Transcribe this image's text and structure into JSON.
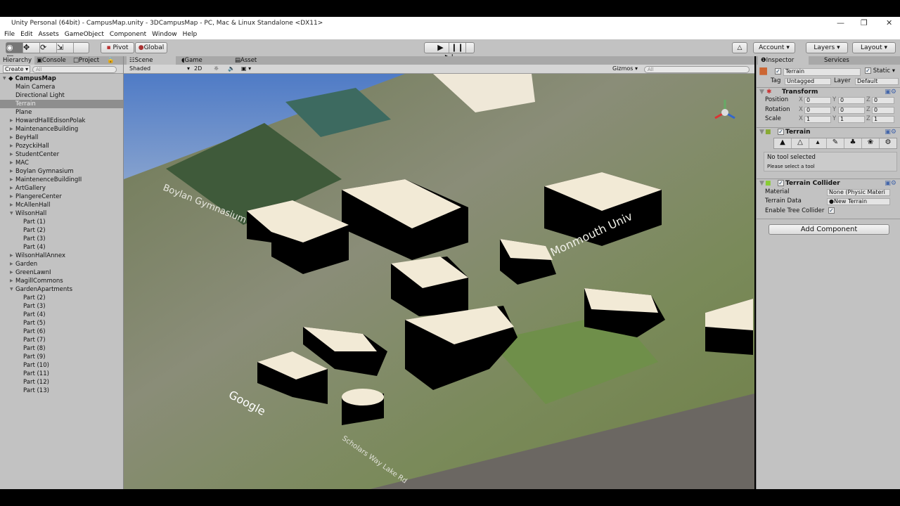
{
  "window": {
    "title": "Unity Personal (64bit) - CampusMap.unity - 3DCampusMap - PC, Mac & Linux Standalone <DX11>"
  },
  "menu": [
    "File",
    "Edit",
    "Assets",
    "GameObject",
    "Component",
    "Window",
    "Help"
  ],
  "toolbar": {
    "pivot": "Pivot",
    "global": "Global",
    "account": "Account",
    "layers": "Layers",
    "layout": "Layout"
  },
  "hierarchy": {
    "tabs": [
      "Hierarchy",
      "Console",
      "Project"
    ],
    "create": "Create",
    "search_placeholder": "All",
    "root": "CampusMap",
    "items": [
      {
        "label": "Main Camera",
        "indent": 1
      },
      {
        "label": "Directional Light",
        "indent": 1
      },
      {
        "label": "Terrain",
        "indent": 1,
        "selected": true
      },
      {
        "label": "Plane",
        "indent": 1
      },
      {
        "label": "HowardHallEdisonPolak",
        "indent": 1,
        "expander": "collapsed"
      },
      {
        "label": "MaintenanceBuilding",
        "indent": 1,
        "expander": "collapsed"
      },
      {
        "label": "BeyHall",
        "indent": 1,
        "expander": "collapsed"
      },
      {
        "label": "PozyckiHall",
        "indent": 1,
        "expander": "collapsed"
      },
      {
        "label": "StudentCenter",
        "indent": 1,
        "expander": "collapsed"
      },
      {
        "label": "MAC",
        "indent": 1,
        "expander": "collapsed"
      },
      {
        "label": "Boylan Gymnasium",
        "indent": 1,
        "expander": "collapsed"
      },
      {
        "label": "MaintenenceBuildingII",
        "indent": 1,
        "expander": "collapsed"
      },
      {
        "label": "ArtGallery",
        "indent": 1,
        "expander": "collapsed"
      },
      {
        "label": "PlangereCenter",
        "indent": 1,
        "expander": "collapsed"
      },
      {
        "label": "McAllenHall",
        "indent": 1,
        "expander": "collapsed"
      },
      {
        "label": "WilsonHall",
        "indent": 1,
        "expander": "expanded"
      },
      {
        "label": "Part (1)",
        "indent": 2
      },
      {
        "label": "Part (2)",
        "indent": 2
      },
      {
        "label": "Part (3)",
        "indent": 2
      },
      {
        "label": "Part (4)",
        "indent": 2
      },
      {
        "label": "WilsonHallAnnex",
        "indent": 1,
        "expander": "collapsed"
      },
      {
        "label": "Garden",
        "indent": 1,
        "expander": "collapsed"
      },
      {
        "label": "GreenLawnI",
        "indent": 1,
        "expander": "collapsed"
      },
      {
        "label": "MagillCommons",
        "indent": 1,
        "expander": "collapsed"
      },
      {
        "label": "GardenApartments",
        "indent": 1,
        "expander": "expanded"
      },
      {
        "label": "Part (2)",
        "indent": 2
      },
      {
        "label": "Part (3)",
        "indent": 2
      },
      {
        "label": "Part (4)",
        "indent": 2
      },
      {
        "label": "Part (5)",
        "indent": 2
      },
      {
        "label": "Part (6)",
        "indent": 2
      },
      {
        "label": "Part (7)",
        "indent": 2
      },
      {
        "label": "Part (8)",
        "indent": 2
      },
      {
        "label": "Part (9)",
        "indent": 2
      },
      {
        "label": "Part (10)",
        "indent": 2
      },
      {
        "label": "Part (11)",
        "indent": 2
      },
      {
        "label": "Part (12)",
        "indent": 2
      },
      {
        "label": "Part (13)",
        "indent": 2
      }
    ]
  },
  "scene": {
    "tabs": [
      "Scene",
      "Game",
      "Asset Store"
    ],
    "shading": "Shaded",
    "mode2d": "2D",
    "gizmos": "Gizmos",
    "search_placeholder": "All",
    "map_labels": [
      "Boylan Gymnasium",
      "Google",
      "Scholars Way Lake Rd",
      "Monmouth Univ"
    ]
  },
  "inspector": {
    "tabs": [
      "Inspector",
      "Services"
    ],
    "object_name": "Terrain",
    "static_label": "Static",
    "tag_label": "Tag",
    "tag": "Untagged",
    "layer_label": "Layer",
    "layer": "Default",
    "transform": {
      "title": "Transform",
      "rows": [
        {
          "label": "Position",
          "x": "0",
          "y": "0",
          "z": "0"
        },
        {
          "label": "Rotation",
          "x": "0",
          "y": "0",
          "z": "0"
        },
        {
          "label": "Scale",
          "x": "1",
          "y": "1",
          "z": "1"
        }
      ]
    },
    "terrain": {
      "title": "Terrain",
      "status": "No tool selected",
      "hint": "Please select a tool"
    },
    "collider": {
      "title": "Terrain Collider",
      "material_label": "Material",
      "material": "None (Physic Materi",
      "data_label": "Terrain Data",
      "data": "New Terrain",
      "tree_label": "Enable Tree Collider"
    },
    "add_component": "Add Component"
  }
}
